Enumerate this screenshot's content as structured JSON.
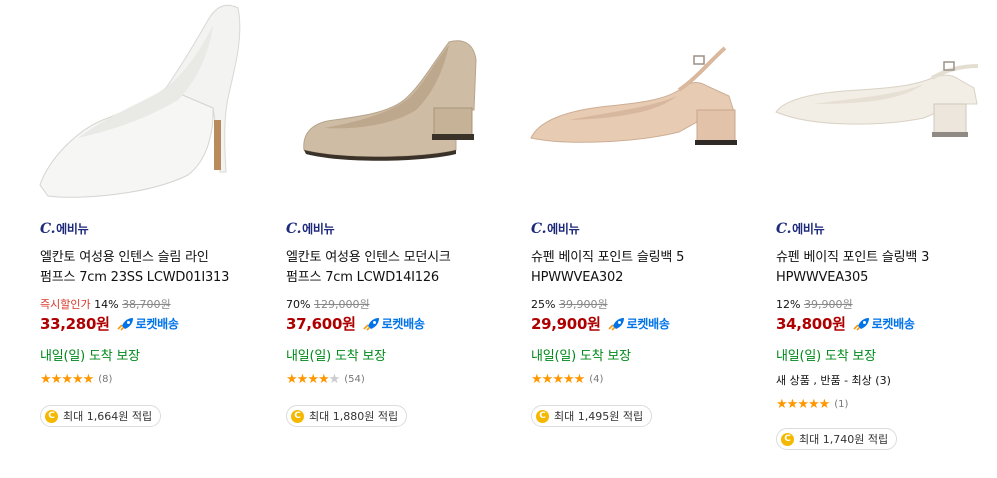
{
  "products": [
    {
      "brand": "C.에비뉴",
      "name_line1": "엘칸토 여성용 인텐스 슬림 라인",
      "name_line2": "펌프스 7cm 23SS LCWD01I313",
      "discount_tag": "즉시할인가",
      "discount_rate": "14%",
      "original_price": "38,700원",
      "price": "33,280원",
      "delivery_badge": "로켓배송",
      "delivery_promise": "내일(일) 도착 보장",
      "rating": 5,
      "review_count": "(8)",
      "points": "최대 1,664원 적립",
      "shoe_color": "#f4f4f2"
    },
    {
      "brand": "C.에비뉴",
      "name_line1": "엘칸토 여성용 인텐스 모던시크",
      "name_line2": "펌프스 7cm LCWD14I126",
      "discount_tag": "",
      "discount_rate": "70%",
      "original_price": "129,000원",
      "price": "37,600원",
      "delivery_badge": "로켓배송",
      "delivery_promise": "내일(일) 도착 보장",
      "rating": 4,
      "review_count": "(54)",
      "points": "최대 1,880원 적립",
      "shoe_color": "#cdbba3"
    },
    {
      "brand": "C.에비뉴",
      "name_line1": "슈펜 베이직 포인트 슬링백 5",
      "name_line2": "HPWWVEA302",
      "discount_tag": "",
      "discount_rate": "25%",
      "original_price": "39,900원",
      "price": "29,900원",
      "delivery_badge": "로켓배송",
      "delivery_promise": "내일(일) 도착 보장",
      "rating": 5,
      "review_count": "(4)",
      "points": "최대 1,495원 적립",
      "shoe_color": "#e6c9b2"
    },
    {
      "brand": "C.에비뉴",
      "name_line1": "슈펜 베이직 포인트 슬링백 3",
      "name_line2": "HPWWVEA305",
      "discount_tag": "",
      "discount_rate": "12%",
      "original_price": "39,900원",
      "price": "34,800원",
      "delivery_badge": "로켓배송",
      "delivery_promise": "내일(일) 도착 보장",
      "other_sellers": "새 상품 , 반품 - 최상 (3)",
      "rating": 5,
      "review_count": "(1)",
      "points": "최대 1,740원 적립",
      "shoe_color": "#f0ebe3"
    }
  ],
  "colors": {
    "price": "#ae0000",
    "discount_tag": "#d83a2c",
    "rocket": "#0073e9",
    "delivery_promise": "#00891a",
    "star": "#ff9800",
    "brand": "#1d2a7a"
  },
  "icons": {
    "rocket": "rocket-icon",
    "star": "star-icon",
    "coin": "coin-icon"
  }
}
